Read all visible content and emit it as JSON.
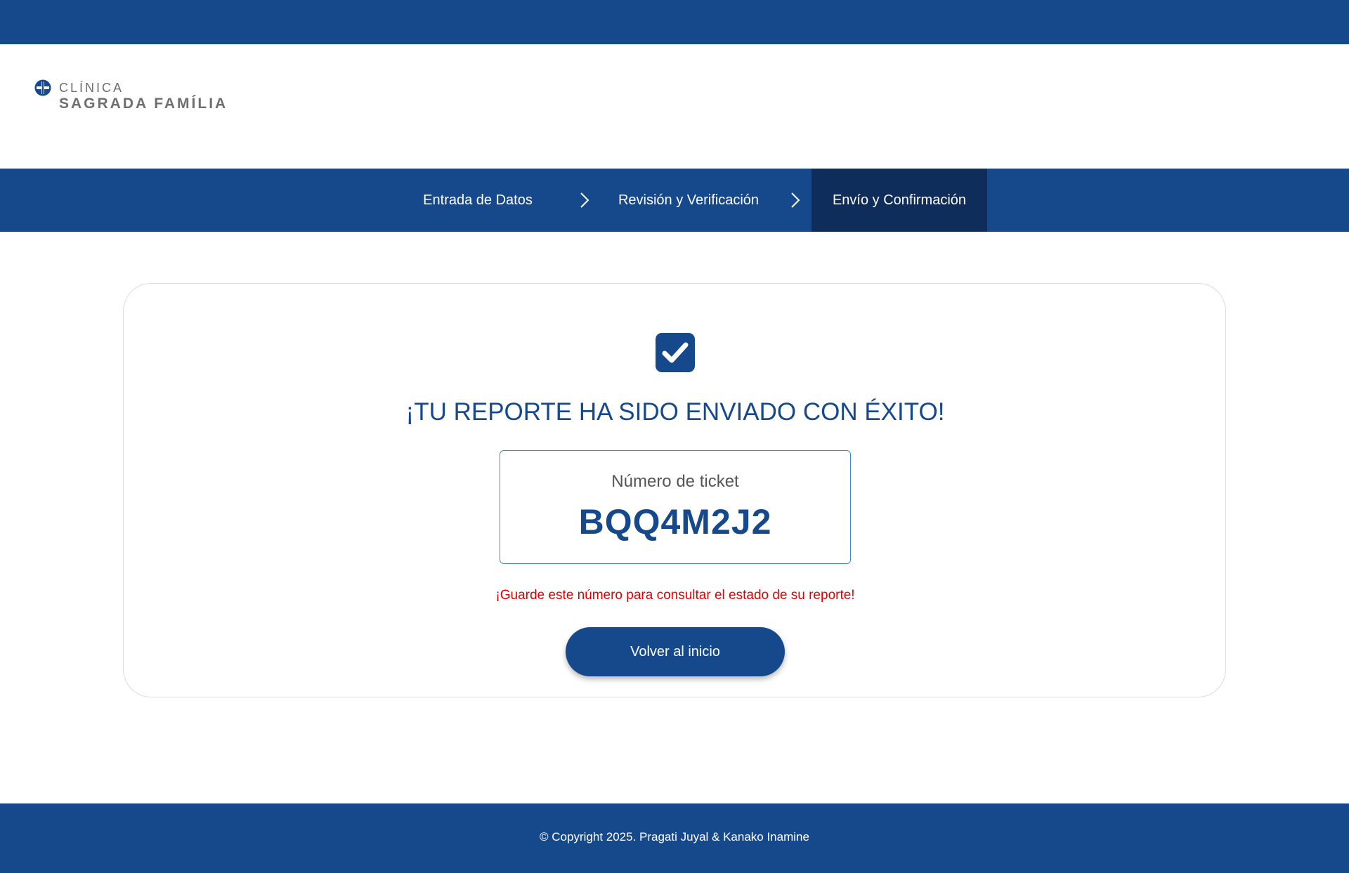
{
  "brand": {
    "line1": "CLÍNICA",
    "line2": "SAGRADA FAMÍLIA",
    "icon": "clinic-cross-logo-icon"
  },
  "steps": [
    {
      "label": "Entrada de Datos",
      "active": false
    },
    {
      "label": "Revisión y Verificación",
      "active": false
    },
    {
      "label": "Envío y Confirmación",
      "active": true
    }
  ],
  "confirmation": {
    "icon": "checkbox-checked-icon",
    "title": "¡TU REPORTE HA SIDO ENVIADO CON ÉXITO!",
    "ticket_label": "Número de ticket",
    "ticket_number": "BQQ4M2J2",
    "warning": "¡Guarde este número para consultar el estado de su reporte!",
    "button_label": "Volver al inicio"
  },
  "footer": {
    "copyright": "© Copyright 2025. Pragati Juyal & Kanako Inamine"
  },
  "colors": {
    "primary": "#16498c",
    "active_step": "#0f2d5a",
    "warning": "#e00000",
    "ticket_border": "#3d86d8"
  }
}
